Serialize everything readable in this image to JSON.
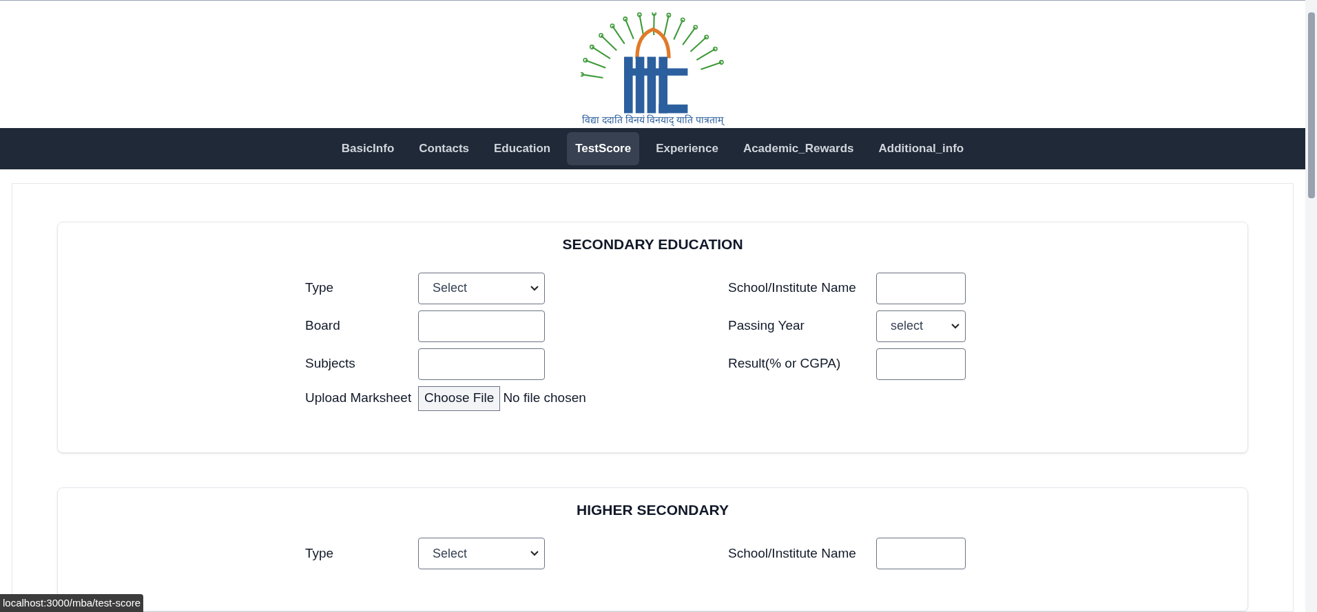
{
  "logo": {
    "motto": "विद्या ददाति विनयं विनयाद् याति पात्रताम्"
  },
  "nav": [
    {
      "label": "BasicInfo",
      "selected": false
    },
    {
      "label": "Contacts",
      "selected": false
    },
    {
      "label": "Education",
      "selected": false
    },
    {
      "label": "TestScore",
      "selected": true
    },
    {
      "label": "Experience",
      "selected": false
    },
    {
      "label": "Academic_Rewards",
      "selected": false
    },
    {
      "label": "Additional_info",
      "selected": false
    }
  ],
  "sections": [
    {
      "title": "SECONDARY EDUCATION",
      "rows": [
        {
          "left": {
            "label": "Type",
            "kind": "select",
            "value": "Select"
          },
          "right": {
            "label": "School/Institute Name",
            "kind": "text"
          }
        },
        {
          "left": {
            "label": "Board",
            "kind": "text"
          },
          "right": {
            "label": "Passing Year",
            "kind": "select",
            "value": "select"
          }
        },
        {
          "left": {
            "label": "Subjects",
            "kind": "text"
          },
          "right": {
            "label": "Result(% or CGPA)",
            "kind": "text"
          }
        },
        {
          "left": {
            "label": "Upload Marksheet",
            "kind": "file",
            "button": "Choose File",
            "value": "No file chosen"
          }
        }
      ]
    },
    {
      "title": "HIGHER SECONDARY",
      "rows": [
        {
          "left": {
            "label": "Type",
            "kind": "select",
            "value": "Select"
          },
          "right": {
            "label": "School/Institute Name",
            "kind": "text"
          }
        }
      ]
    }
  ],
  "status_url": "localhost:3000/mba/test-score"
}
